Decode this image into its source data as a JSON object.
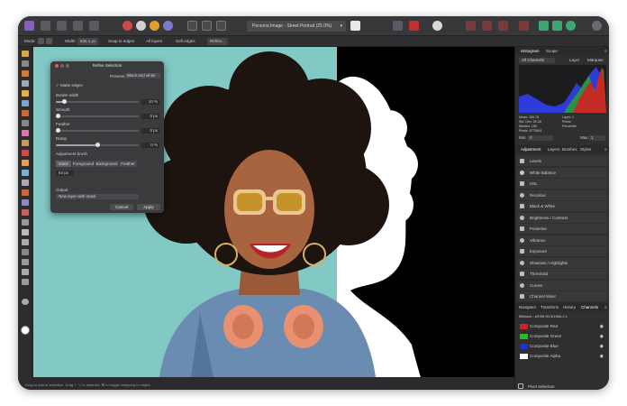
{
  "toolbar": {
    "document_title": "Persona Image - Street Portrait (25.0%)"
  },
  "context_toolbar": {
    "mode_label": "Mode:",
    "width_label": "Width:",
    "width_value": "526.1 px",
    "snap_label": "Snap to edges",
    "layers_label": "All layers",
    "soft_edges_label": "Soft edges",
    "refine_button": "Refine..."
  },
  "status_bar": {
    "text": "Drag to add to selection. Drag + ⌥ to subtract. ⌘ to toggle snapping to edges"
  },
  "refine_dialog": {
    "title": "Refine Selection",
    "preview_label": "Preview:",
    "preview_value": "Black and white",
    "matte_edges_label": "Matte edges",
    "border_width_label": "Border width",
    "border_width_value": "10 %",
    "border_width_level": 0.1,
    "smooth_label": "Smooth",
    "smooth_value": "0 px",
    "smooth_level": 0,
    "feather_label": "Feather",
    "feather_value": "0 px",
    "feather_level": 0,
    "ramp_label": "Ramp",
    "ramp_value": "0 %",
    "ramp_level": 0.5,
    "adjustment_label": "Adjustment brush",
    "segments": [
      "Matte",
      "Foreground",
      "Background",
      "Feather"
    ],
    "brush_size": "64 px",
    "output_label": "Output",
    "output_value": "New layer with mask",
    "cancel_button": "Cancel",
    "apply_button": "Apply"
  },
  "right_panel": {
    "histogram_tabs": [
      "Histogram",
      "Scope"
    ],
    "channel_select": "All Channels",
    "histogram_options": [
      "Layer",
      "Marquee"
    ],
    "stats": {
      "mean": "Mean: 160.78",
      "std_dev": "Std. Dev: 59.38",
      "median": "Median: 156",
      "pixels": "Pixels: 6775801",
      "layer": "Layer: 1",
      "pixels_label": "Pixels",
      "percentile": "Percentile"
    },
    "min_label": "Min:",
    "min_value": "0",
    "max_label": "Max:",
    "max_value": "1",
    "adjustment_tabs": [
      "Adjustment",
      "Layers",
      "Brushes",
      "Styles"
    ],
    "adjustments": [
      "Levels",
      "White Balance",
      "HSL",
      "Recolour",
      "Black & White",
      "Brightness / Contrast",
      "Posterise",
      "Vibrance",
      "Exposure",
      "Shadows / Highlights",
      "Threshold",
      "Curves",
      "Channel Mixer"
    ],
    "channel_tabs": [
      "Navigator",
      "Transform",
      "History",
      "Channels"
    ],
    "profile": "Bitblock - sRGB IEC61966-2.1",
    "channels": [
      {
        "label": "Composite Red",
        "color": "#d42020"
      },
      {
        "label": "Composite Green",
        "color": "#20c020"
      },
      {
        "label": "Composite Blue",
        "color": "#2030d8"
      },
      {
        "label": "Composite Alpha",
        "color": "#ffffff"
      }
    ],
    "pixel_selection": "Pixel Selection"
  }
}
